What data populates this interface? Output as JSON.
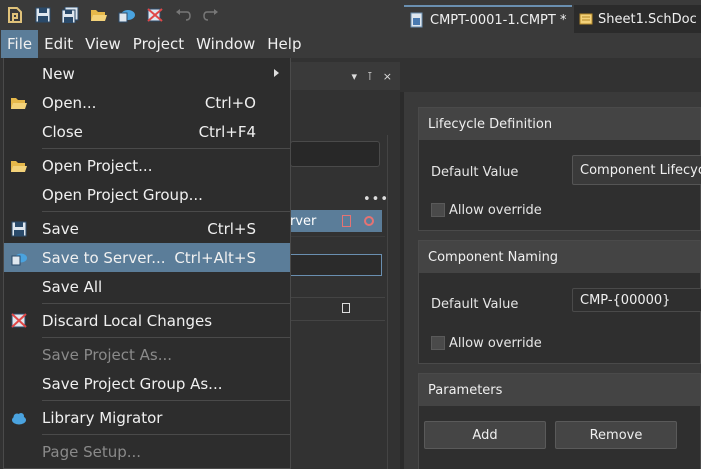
{
  "toolbar": {
    "icons": [
      "app-logo-icon",
      "save-icon",
      "save-all-icon",
      "open-folder-icon",
      "save-to-server-icon",
      "discard-changes-icon",
      "undo-icon",
      "redo-icon"
    ]
  },
  "menubar": {
    "items": [
      "File",
      "Edit",
      "View",
      "Project",
      "Window",
      "Help"
    ]
  },
  "file_menu": {
    "new": "New",
    "open": "Open...",
    "open_shortcut": "Ctrl+O",
    "close": "Close",
    "close_shortcut": "Ctrl+F4",
    "open_project": "Open Project...",
    "open_project_group": "Open Project Group...",
    "save": "Save",
    "save_shortcut": "Ctrl+S",
    "save_to_server": "Save to Server...",
    "save_to_server_shortcut": "Ctrl+Alt+S",
    "save_all": "Save All",
    "discard": "Discard Local Changes",
    "save_project_as": "Save Project As...",
    "save_project_group_as": "Save Project Group As...",
    "library_migrator": "Library Migrator",
    "page_setup": "Page Setup..."
  },
  "left_panel": {
    "selected_row_text": "rver",
    "dots": "•••",
    "pin": "⊺",
    "close": "×",
    "dropdown": "▾"
  },
  "tabs": {
    "active": "CMPT-0001-1.CMPT *",
    "inactive": "Sheet1.SchDoc"
  },
  "lifecycle": {
    "title": "Lifecycle Definition",
    "default_label": "Default Value",
    "default_value": "Component Lifecycle",
    "allow_override": "Allow override"
  },
  "naming": {
    "title": "Component Naming",
    "default_label": "Default Value",
    "default_value": "CMP-{00000}",
    "allow_override": "Allow override"
  },
  "parameters": {
    "title": "Parameters",
    "add": "Add",
    "remove": "Remove"
  },
  "colors": {
    "highlight": "#5b7d99",
    "background": "#2b2b2b",
    "accent_red": "#e57373"
  }
}
